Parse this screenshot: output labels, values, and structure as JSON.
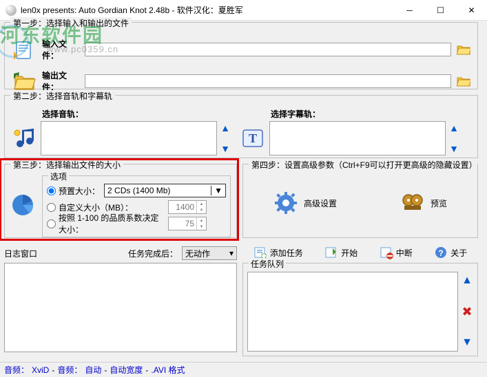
{
  "titlebar": {
    "title": "len0x presents: Auto Gordian Knot 2.48b - 软件汉化：夏胜军"
  },
  "watermark": {
    "main": "河东软件园",
    "sub": "www.pc0359.cn"
  },
  "step1": {
    "legend": "第一步：选择输入和输出的文件",
    "input_label": "输入文件：",
    "output_label": "输出文件：",
    "input_value": "",
    "output_value": ""
  },
  "step2": {
    "legend": "第二步：选择音轨和字幕轨",
    "audio_label": "选择音轨：",
    "subtitle_label": "选择字幕轨："
  },
  "step3": {
    "legend": "第三步：选择输出文件的大小",
    "options_legend": "选项",
    "preset_label": "预置大小：",
    "preset_value": "2 CDs (1400 Mb)",
    "custom_label": "自定义大小（MB）：",
    "custom_value": "1400",
    "quality_label": "按照 1-100 的品质系数决定大小：",
    "quality_value": "75"
  },
  "step4": {
    "legend": "第四步：设置高级参数（Ctrl+F9可以打开更高级的隐藏设置）",
    "adv_label": "高级设置",
    "preview_label": "预览"
  },
  "actions": {
    "add": "添加任务",
    "start": "开始",
    "stop": "中断",
    "about": "关于"
  },
  "log": {
    "label": "日志窗口",
    "after_label": "任务完成后：",
    "after_value": "无动作"
  },
  "queue": {
    "legend": "任务队列"
  },
  "status": {
    "video_label": "音频：",
    "video_value": "XviD",
    "audio_label": "音频：",
    "audio_value": "自动",
    "width_label": "自动宽度",
    "format": ".AVI 格式"
  }
}
